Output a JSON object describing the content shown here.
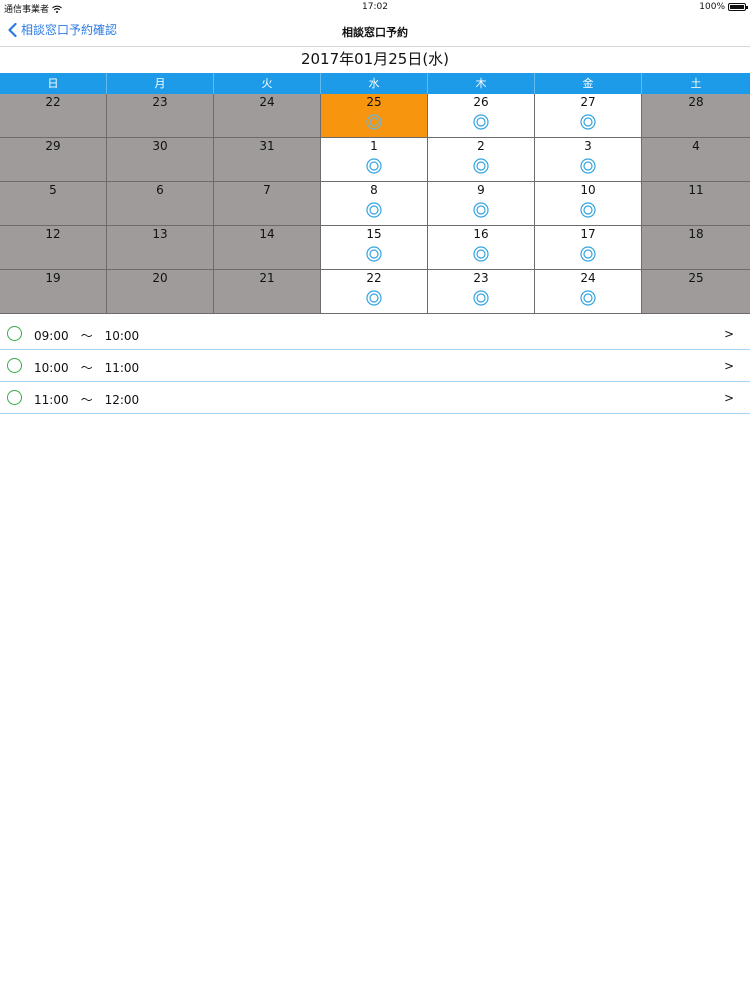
{
  "status_bar": {
    "carrier": "通信事業者",
    "time": "17:02",
    "battery": "100%"
  },
  "nav": {
    "back_label": "相談窓口予約確認",
    "title": "相談窓口予約"
  },
  "date_heading": "2017年01月25日(水)",
  "calendar": {
    "weekdays": [
      "日",
      "月",
      "火",
      "水",
      "木",
      "金",
      "土"
    ],
    "weeks": [
      [
        {
          "day": "22",
          "state": "closed",
          "mark": ""
        },
        {
          "day": "23",
          "state": "closed",
          "mark": ""
        },
        {
          "day": "24",
          "state": "closed",
          "mark": ""
        },
        {
          "day": "25",
          "state": "selected",
          "mark": "◎"
        },
        {
          "day": "26",
          "state": "open",
          "mark": "◎"
        },
        {
          "day": "27",
          "state": "open",
          "mark": "◎"
        },
        {
          "day": "28",
          "state": "closed",
          "mark": ""
        }
      ],
      [
        {
          "day": "29",
          "state": "closed",
          "mark": ""
        },
        {
          "day": "30",
          "state": "closed",
          "mark": ""
        },
        {
          "day": "31",
          "state": "closed",
          "mark": ""
        },
        {
          "day": "1",
          "state": "open",
          "mark": "◎"
        },
        {
          "day": "2",
          "state": "open",
          "mark": "◎"
        },
        {
          "day": "3",
          "state": "open",
          "mark": "◎"
        },
        {
          "day": "4",
          "state": "closed",
          "mark": ""
        }
      ],
      [
        {
          "day": "5",
          "state": "closed",
          "mark": ""
        },
        {
          "day": "6",
          "state": "closed",
          "mark": ""
        },
        {
          "day": "7",
          "state": "closed",
          "mark": ""
        },
        {
          "day": "8",
          "state": "open",
          "mark": "◎"
        },
        {
          "day": "9",
          "state": "open",
          "mark": "◎"
        },
        {
          "day": "10",
          "state": "open",
          "mark": "◎"
        },
        {
          "day": "11",
          "state": "closed",
          "mark": ""
        }
      ],
      [
        {
          "day": "12",
          "state": "closed",
          "mark": ""
        },
        {
          "day": "13",
          "state": "closed",
          "mark": ""
        },
        {
          "day": "14",
          "state": "closed",
          "mark": ""
        },
        {
          "day": "15",
          "state": "open",
          "mark": "◎"
        },
        {
          "day": "16",
          "state": "open",
          "mark": "◎"
        },
        {
          "day": "17",
          "state": "open",
          "mark": "◎"
        },
        {
          "day": "18",
          "state": "closed",
          "mark": ""
        }
      ],
      [
        {
          "day": "19",
          "state": "closed",
          "mark": ""
        },
        {
          "day": "20",
          "state": "closed",
          "mark": ""
        },
        {
          "day": "21",
          "state": "closed",
          "mark": ""
        },
        {
          "day": "22",
          "state": "open",
          "mark": "◎"
        },
        {
          "day": "23",
          "state": "open",
          "mark": "◎"
        },
        {
          "day": "24",
          "state": "open",
          "mark": "◎"
        },
        {
          "day": "25",
          "state": "closed",
          "mark": ""
        }
      ]
    ]
  },
  "time_slots": [
    {
      "label": "09:00　〜　10:00",
      "chevron": ">"
    },
    {
      "label": "10:00　〜　11:00",
      "chevron": ">"
    },
    {
      "label": "11:00　〜　12:00",
      "chevron": ">"
    }
  ],
  "colors": {
    "accent": "#1e9be8",
    "selected": "#f7950f",
    "closed": "#a09b9b",
    "link": "#2a7ae2",
    "available_mark": "#35a4e2",
    "radio": "#3aaa4a"
  },
  "icons": {
    "back": "chevron-left-icon",
    "wifi": "wifi-icon",
    "battery": "battery-icon",
    "available": "double-circle-icon",
    "slot": "radio-circle-icon"
  }
}
